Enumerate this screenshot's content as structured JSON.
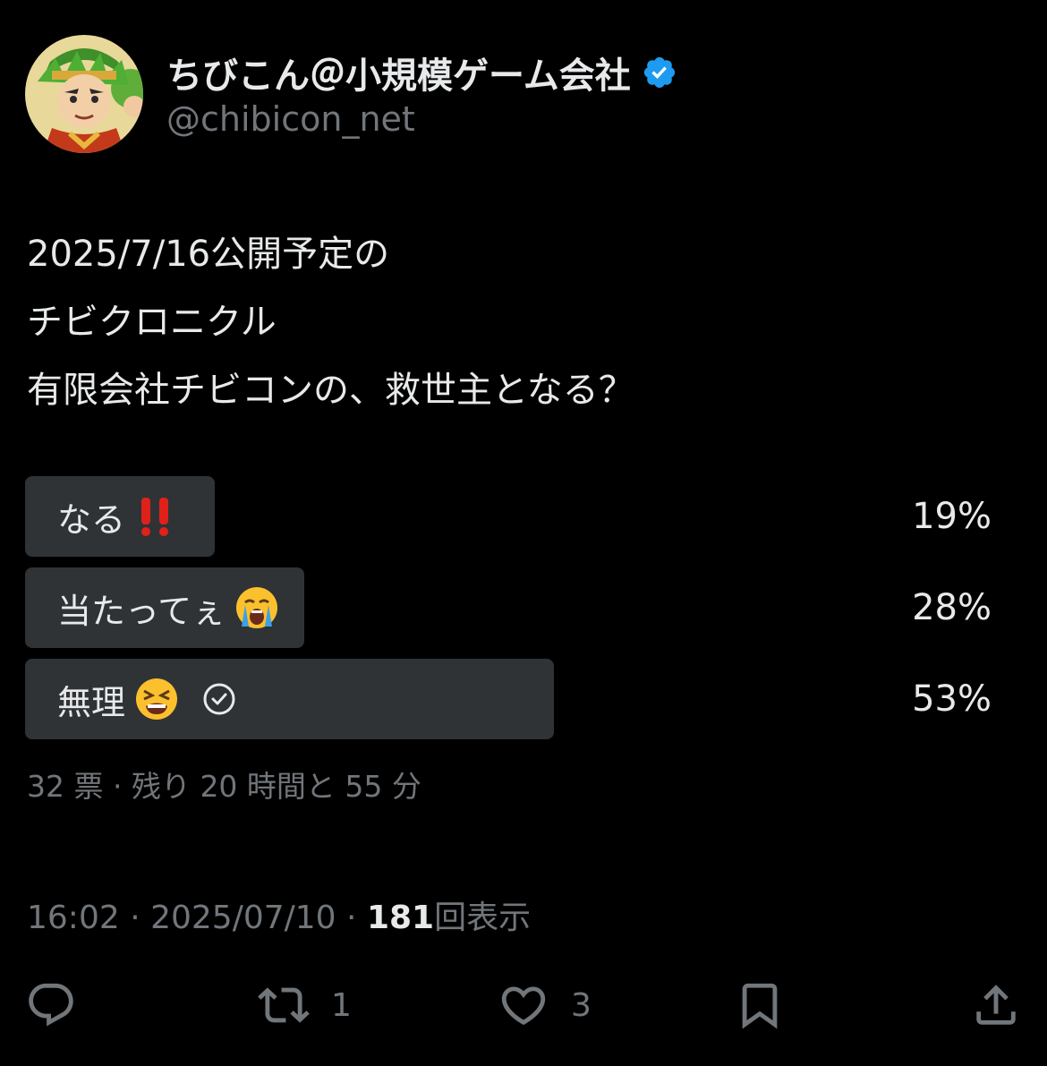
{
  "user": {
    "display_name": "ちびこん＠小規模ゲーム会社",
    "handle": "@chibicon_net",
    "verified": true
  },
  "tweet": {
    "lines": [
      "2025/7/16公開予定の",
      "チビクロニクル",
      "有限会社チビコンの、救世主となる？"
    ]
  },
  "poll": {
    "options": [
      {
        "label": "なる",
        "emoji": "double-exclamation",
        "percent_text": "19%",
        "percent": 19,
        "selected": false
      },
      {
        "label": "当たってぇ",
        "emoji": "loudly-crying-face",
        "percent_text": "28%",
        "percent": 28,
        "selected": false
      },
      {
        "label": "無理",
        "emoji": "tired-face",
        "percent_text": "53%",
        "percent": 53,
        "selected": true
      }
    ],
    "meta": "32 票 · 残り 20 時間と 55 分"
  },
  "meta": {
    "time": "16:02",
    "date": "2025/07/10",
    "views_count": "181",
    "views_label": "回表示",
    "separator": " · "
  },
  "actions": {
    "reply_count": "",
    "retweet_count": "1",
    "like_count": "3"
  },
  "colors": {
    "background": "#000000",
    "text": "#e7e9ea",
    "muted": "#71767b",
    "poll_bar": "#2f3336",
    "verified": "#1d9bf0"
  }
}
